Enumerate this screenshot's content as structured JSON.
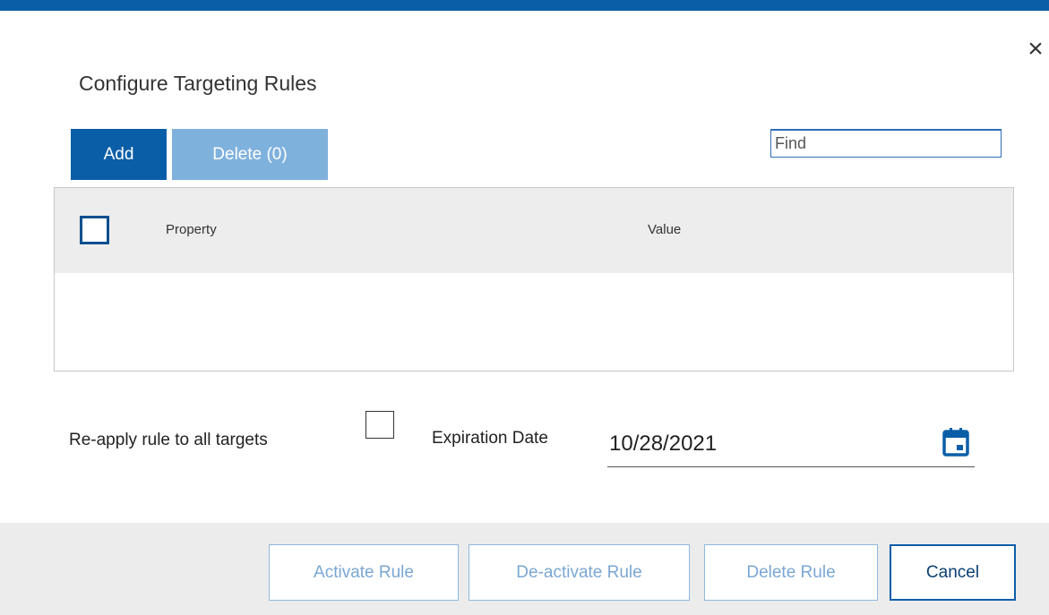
{
  "dialog": {
    "title": "Configure Targeting Rules",
    "close_label": "×",
    "accent_color": "#0a5ea8"
  },
  "toolbar": {
    "add_label": "Add",
    "delete_label": "Delete (0)",
    "find_placeholder": "Find",
    "find_value": ""
  },
  "grid": {
    "columns": [
      "Property",
      "Value"
    ],
    "select_all_checked": false,
    "rows": []
  },
  "options": {
    "reapply_label": "Re-apply rule to all targets",
    "reapply_checked": false,
    "expiration_label": "Expiration Date",
    "expiration_value": "10/28/2021",
    "calendar_icon": "calendar-icon"
  },
  "footer": {
    "activate_label": "Activate Rule",
    "deactivate_label": "De-activate Rule",
    "delete_rule_label": "Delete Rule",
    "cancel_label": "Cancel"
  }
}
